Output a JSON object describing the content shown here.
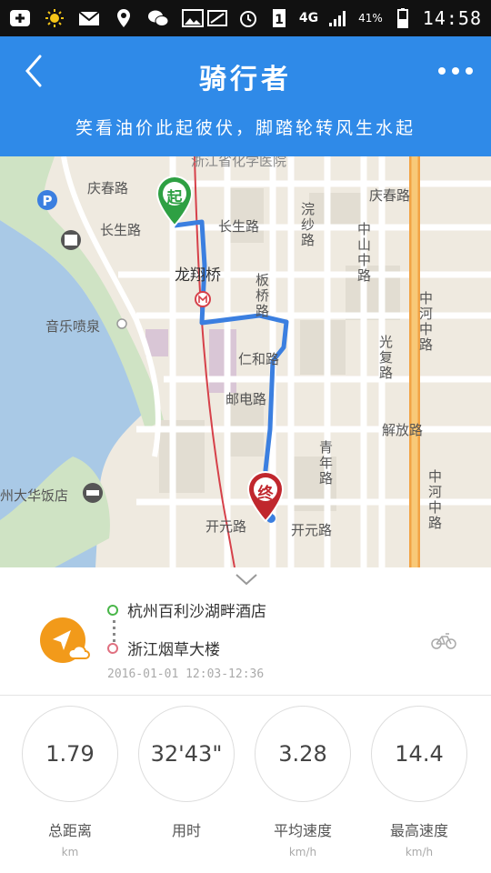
{
  "status_bar": {
    "icons": [
      "add-icon",
      "sun-icon",
      "mail-icon",
      "location-icon",
      "wechat-icon",
      "image-icon",
      "nfc-icon",
      "alarm-icon",
      "sim-icon",
      "4g-icon",
      "signal-icon",
      "battery-icon"
    ],
    "network": "4G",
    "battery": "41%",
    "time": "14:58"
  },
  "header": {
    "title": "骑行者",
    "subtitle": "笑看油价此起彼伏，脚踏轮转风生水起"
  },
  "map": {
    "labels": {
      "top_street": "浙江省化学医院",
      "qingchun_left": "庆春路",
      "qingchun_right": "庆春路",
      "changsheng_left": "长生路",
      "changsheng_right": "长生路",
      "longxiangqiao": "龙翔桥",
      "yinyuepenquan": "音乐喷泉",
      "renhe": "仁和路",
      "youdian": "邮电路",
      "jiefang": "解放路",
      "kaiyuan_left": "开元路",
      "kaiyuan_right": "开元路",
      "dahuafandian": "州大华饭店",
      "huansha": "浣纱路",
      "zhongshan": "中山中路",
      "yanqiao": "板桥路",
      "qingnian": "青年路",
      "guangfu": "光复路",
      "zhonghe": "中河中路",
      "zhonghe2": "中河中路"
    },
    "start_marker": "起",
    "end_marker": "终",
    "colors": {
      "route": "#3b7fe0",
      "start": "#2ea043",
      "end": "#c0272d",
      "water": "#a9c9e6",
      "park": "#cfe3c4"
    }
  },
  "trip": {
    "start": "杭州百利沙湖畔酒店",
    "end": "浙江烟草大楼",
    "datetime": "2016-01-01  12:03-12:36"
  },
  "stats": [
    {
      "value": "1.79",
      "label": "总距离",
      "unit": "km"
    },
    {
      "value": "32'43\"",
      "label": "用时",
      "unit": ""
    },
    {
      "value": "3.28",
      "label": "平均速度",
      "unit": "km/h"
    },
    {
      "value": "14.4",
      "label": "最高速度",
      "unit": "km/h"
    }
  ]
}
